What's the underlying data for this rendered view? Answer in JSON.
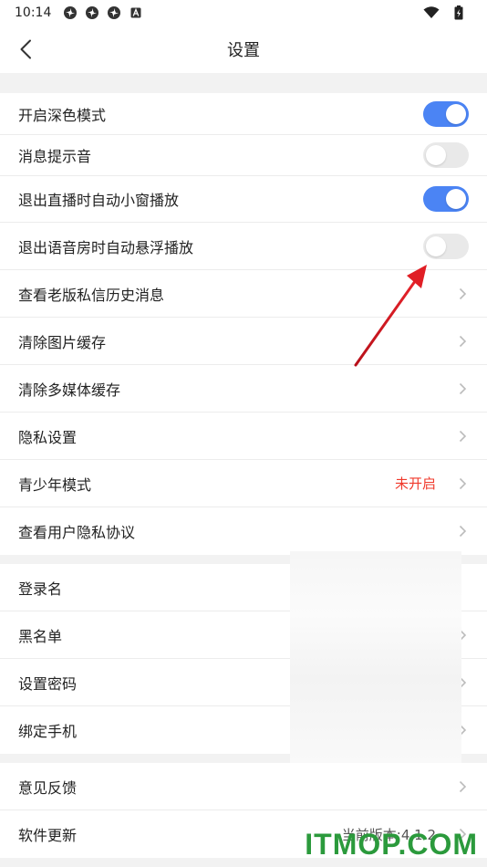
{
  "status_bar": {
    "time": "10:14",
    "icons": [
      "pinwheel-icon",
      "pinwheel-icon",
      "pinwheel-icon",
      "a-icon"
    ],
    "right_icons": [
      "wifi-icon",
      "battery-icon"
    ]
  },
  "nav": {
    "title": "设置",
    "back_icon": "back-icon"
  },
  "groups": [
    {
      "items": [
        {
          "label": "开启深色模式",
          "type": "toggle",
          "on": true
        },
        {
          "label": "消息提示音",
          "type": "toggle",
          "on": false
        },
        {
          "label": "退出直播时自动小窗播放",
          "type": "toggle",
          "on": true
        },
        {
          "label": "退出语音房时自动悬浮播放",
          "type": "toggle",
          "on": false
        },
        {
          "label": "查看老版私信历史消息",
          "type": "link"
        },
        {
          "label": "清除图片缓存",
          "type": "link"
        },
        {
          "label": "清除多媒体缓存",
          "type": "link"
        },
        {
          "label": "隐私设置",
          "type": "link"
        },
        {
          "label": "青少年模式",
          "type": "link",
          "value": "未开启"
        },
        {
          "label": "查看用户隐私协议",
          "type": "link"
        }
      ]
    },
    {
      "items": [
        {
          "label": "登录名",
          "type": "link"
        },
        {
          "label": "黑名单",
          "type": "link"
        },
        {
          "label": "设置密码",
          "type": "link"
        },
        {
          "label": "绑定手机",
          "type": "link"
        }
      ]
    },
    {
      "items": [
        {
          "label": "意见反馈",
          "type": "link"
        },
        {
          "label": "软件更新",
          "type": "link",
          "value": "当前版本:4.1.2"
        }
      ]
    }
  ],
  "watermark": "ITMOP.COM",
  "colors": {
    "accent": "#4b84f4",
    "warning": "#f0392b",
    "annotation_arrow": "#d9151b",
    "watermark": "#2b9a3c"
  }
}
